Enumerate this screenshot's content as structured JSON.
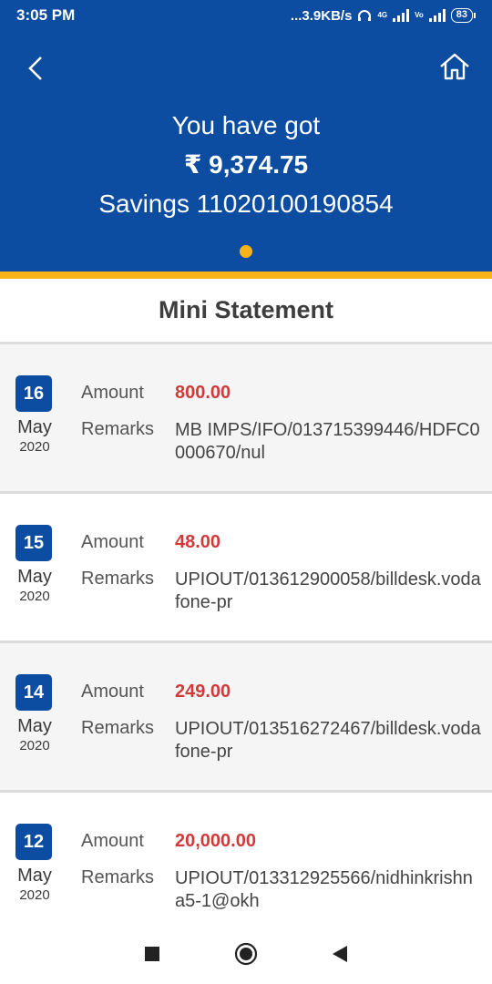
{
  "status_bar": {
    "time": "3:05 PM",
    "speed": "...3.9KB/s",
    "network_tag": "4G",
    "volte_tag": "Vo",
    "battery": "83"
  },
  "header": {
    "greeting": "You have got",
    "balance": "₹ 9,374.75",
    "account": "Savings 11020100190854"
  },
  "section_title": "Mini Statement",
  "labels": {
    "amount": "Amount",
    "remarks": "Remarks"
  },
  "transactions": [
    {
      "day": "16",
      "month": "May",
      "year": "2020",
      "amount": "800.00",
      "remarks": "MB IMPS/IFO/013715399446/HDFC0000670/nul"
    },
    {
      "day": "15",
      "month": "May",
      "year": "2020",
      "amount": "48.00",
      "remarks": "UPIOUT/013612900058/billdesk.vodafone-pr"
    },
    {
      "day": "14",
      "month": "May",
      "year": "2020",
      "amount": "249.00",
      "remarks": "UPIOUT/013516272467/billdesk.vodafone-pr"
    },
    {
      "day": "12",
      "month": "May",
      "year": "2020",
      "amount": "20,000.00",
      "remarks": "UPIOUT/013312925566/nidhinkrishna5-1@okh"
    }
  ],
  "colors": {
    "brand_blue": "#0c4da2",
    "accent_yellow": "#f9b31a",
    "debit_red": "#d23a3a"
  },
  "icons": {
    "back": "chevron-left-icon",
    "home": "home-icon",
    "nav_recents": "square-icon",
    "nav_home": "circle-icon",
    "nav_back": "triangle-back-icon"
  }
}
